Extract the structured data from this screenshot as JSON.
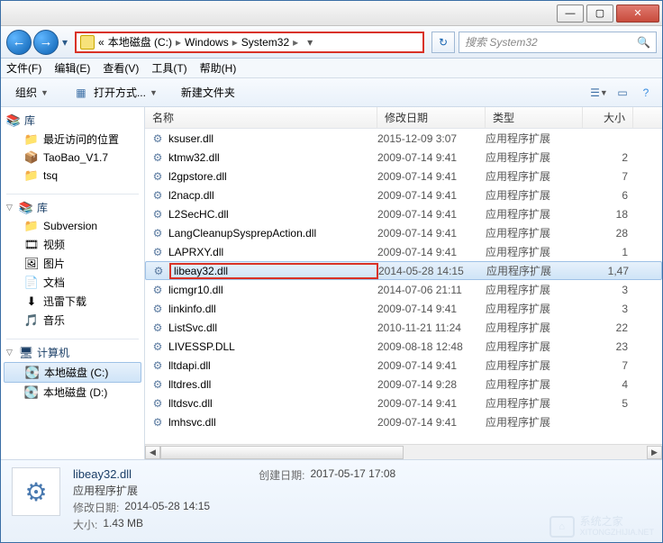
{
  "titlebar": {
    "min": "—",
    "max": "▢",
    "close": "✕"
  },
  "nav": {
    "prefix": "«",
    "crumbs": [
      "本地磁盘 (C:)",
      "Windows",
      "System32"
    ],
    "sep": "▸",
    "refresh": "↻"
  },
  "search": {
    "placeholder": "搜索 System32",
    "icon": "🔍"
  },
  "menu": {
    "file": "文件(F)",
    "edit": "编辑(E)",
    "view": "查看(V)",
    "tools": "工具(T)",
    "help": "帮助(H)"
  },
  "toolbar": {
    "organize": "组织",
    "openwith": "打开方式...",
    "newfolder": "新建文件夹"
  },
  "sidebar": {
    "lib_head": "库",
    "recent": "最近访问的位置",
    "taobao": "TaoBao_V1.7",
    "tsq": "tsq",
    "lib2": "库",
    "subversion": "Subversion",
    "video": "视频",
    "pictures": "图片",
    "docs": "文档",
    "xunlei": "迅雷下载",
    "music": "音乐",
    "computer": "计算机",
    "drive_c": "本地磁盘 (C:)",
    "drive_d": "本地磁盘 (D:)"
  },
  "columns": {
    "name": "名称",
    "date": "修改日期",
    "type": "类型",
    "size": "大小"
  },
  "type_ext": "应用程序扩展",
  "files": [
    {
      "name": "ksuser.dll",
      "date": "2015-12-09 3:07",
      "size": ""
    },
    {
      "name": "ktmw32.dll",
      "date": "2009-07-14 9:41",
      "size": "2"
    },
    {
      "name": "l2gpstore.dll",
      "date": "2009-07-14 9:41",
      "size": "7"
    },
    {
      "name": "l2nacp.dll",
      "date": "2009-07-14 9:41",
      "size": "6"
    },
    {
      "name": "L2SecHC.dll",
      "date": "2009-07-14 9:41",
      "size": "18"
    },
    {
      "name": "LangCleanupSysprepAction.dll",
      "date": "2009-07-14 9:41",
      "size": "28"
    },
    {
      "name": "LAPRXY.dll",
      "date": "2009-07-14 9:41",
      "size": "1"
    },
    {
      "name": "libeay32.dll",
      "date": "2014-05-28 14:15",
      "size": "1,47",
      "selected": true,
      "boxed": true
    },
    {
      "name": "licmgr10.dll",
      "date": "2014-07-06 21:11",
      "size": "3"
    },
    {
      "name": "linkinfo.dll",
      "date": "2009-07-14 9:41",
      "size": "3"
    },
    {
      "name": "ListSvc.dll",
      "date": "2010-11-21 11:24",
      "size": "22"
    },
    {
      "name": "LIVESSP.DLL",
      "date": "2009-08-18 12:48",
      "size": "23"
    },
    {
      "name": "lltdapi.dll",
      "date": "2009-07-14 9:41",
      "size": "7"
    },
    {
      "name": "lltdres.dll",
      "date": "2009-07-14 9:28",
      "size": "4"
    },
    {
      "name": "lltdsvc.dll",
      "date": "2009-07-14 9:41",
      "size": "5"
    },
    {
      "name": "lmhsvc.dll",
      "date": "2009-07-14 9:41",
      "size": ""
    }
  ],
  "details": {
    "name": "libeay32.dll",
    "type": "应用程序扩展",
    "mod_label": "修改日期:",
    "mod": "2014-05-28 14:15",
    "size_label": "大小:",
    "size": "1.43 MB",
    "created_label": "创建日期:",
    "created": "2017-05-17 17:08"
  },
  "watermark": {
    "brand": "系统之家",
    "url": "XITONGZHIJIA.NET"
  }
}
